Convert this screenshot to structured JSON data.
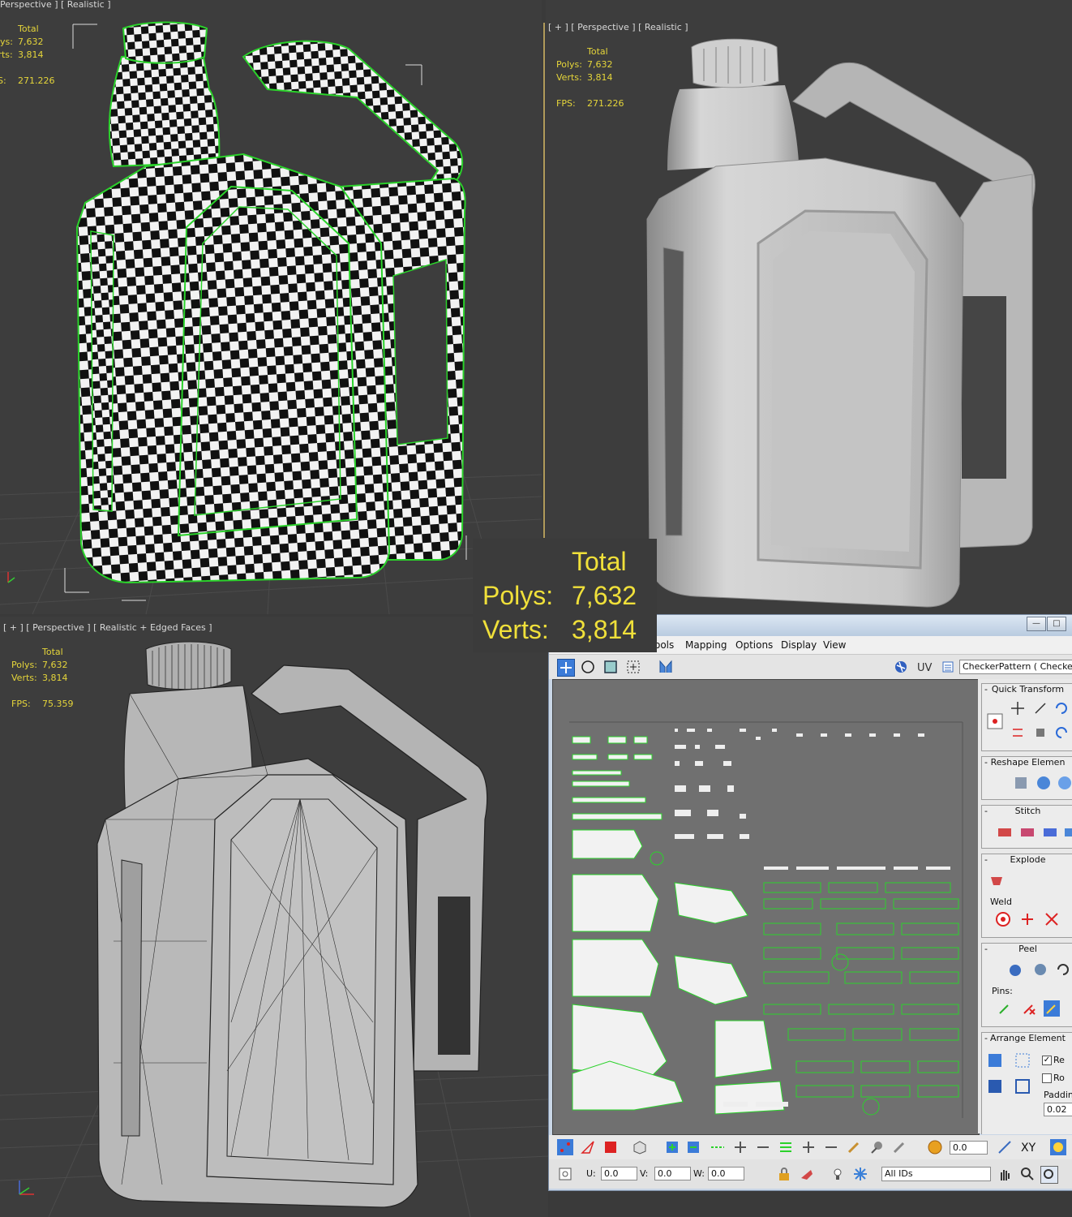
{
  "viewports": {
    "top_left": {
      "label": "Perspective ] [ Realistic ]",
      "stats": {
        "header": "Total",
        "polys_label": "Polys:",
        "polys": "7,632",
        "verts_label": "Verts:",
        "verts": "3,814",
        "fps_label": "FPS:",
        "fps": "271.226"
      }
    },
    "top_right": {
      "label": "[ + ] [ Perspective ] [ Realistic ]",
      "stats": {
        "header": "Total",
        "polys_label": "Polys:",
        "polys": "7,632",
        "verts_label": "Verts:",
        "verts": "3,814",
        "fps_label": "FPS:",
        "fps": "271.226"
      }
    },
    "bottom_left": {
      "label": "[ + ] [ Perspective ] [ Realistic + Edged Faces ]",
      "stats": {
        "header": "Total",
        "polys_label": "Polys:",
        "polys": "7,632",
        "verts_label": "Verts:",
        "verts": "3,814",
        "fps_label": "FPS:",
        "fps": "75.359"
      }
    }
  },
  "big_stats": {
    "header": "Total",
    "polys_label": "Polys:",
    "polys": "7,632",
    "verts_label": "Verts:",
    "verts": "3,814"
  },
  "uv_editor": {
    "menu": [
      "ools",
      "Mapping",
      "Options",
      "Display",
      "View"
    ],
    "uv_label": "UV",
    "texture_dropdown": "CheckerPattern  ( Checker )",
    "panel": {
      "quick_transform": "Quick Transform",
      "reshape": "Reshape Elemen",
      "stitch": "Stitch",
      "explode": "Explode",
      "weld": "Weld",
      "peel": "Peel",
      "pins": "Pins:",
      "arrange": "Arrange Element",
      "opt_re": "Re",
      "opt_ro": "Ro",
      "padding_label": "Paddin",
      "padding_value": "0.02"
    },
    "bottom": {
      "spinner_value": "0.0",
      "xy": "XY",
      "u_label": "U:",
      "u_value": "0.0",
      "v_label": "V:",
      "v_value": "0.0",
      "w_label": "W:",
      "w_value": "0.0",
      "ids_dropdown": "All IDs"
    }
  },
  "colors": {
    "stats_yellow": "#e5d53a",
    "wire_green": "#2bd22b",
    "viewport_bg": "#3d3d3d"
  }
}
